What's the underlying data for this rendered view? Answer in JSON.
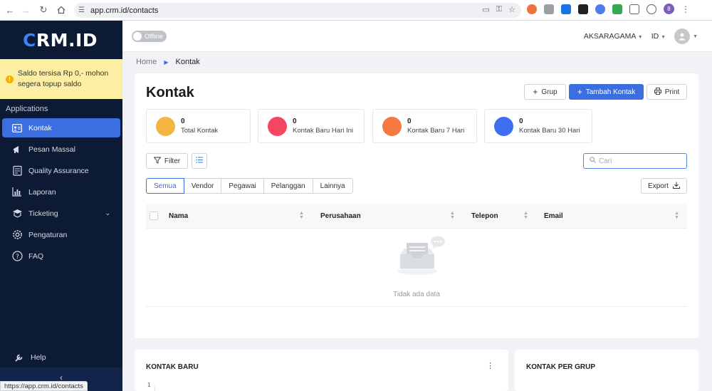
{
  "browser": {
    "url": "app.crm.id/contacts",
    "profile_initial": "8",
    "status_url": "https://app.crm.id/contacts"
  },
  "sidebar": {
    "logo": "CRM.ID",
    "logo_rest": "RM.ID",
    "balance_notice": "Saldo tersisa Rp 0,- mohon segera topup saldo",
    "section_label": "Applications",
    "items": [
      {
        "label": "Kontak",
        "icon": "contact-card-icon",
        "active": true
      },
      {
        "label": "Pesan Massal",
        "icon": "bullhorn-icon"
      },
      {
        "label": "Quality Assurance",
        "icon": "clipboard-check-icon"
      },
      {
        "label": "Laporan",
        "icon": "bar-chart-icon"
      },
      {
        "label": "Ticketing",
        "icon": "ticket-icon",
        "has_submenu": true
      },
      {
        "label": "Pengaturan",
        "icon": "gear-icon"
      },
      {
        "label": "FAQ",
        "icon": "question-icon"
      }
    ],
    "help_label": "Help"
  },
  "topbar": {
    "status_toggle": "Offline",
    "organization": "AKSARAGAMA",
    "language": "ID"
  },
  "breadcrumb": {
    "home": "Home",
    "current": "Kontak"
  },
  "main": {
    "title": "Kontak",
    "buttons": {
      "group": "Grup",
      "add_contact": "Tambah Kontak",
      "print": "Print"
    },
    "stats": [
      {
        "value": "0",
        "label": "Total Kontak",
        "color": "#f4b642"
      },
      {
        "value": "0",
        "label": "Kontak Baru Hari Ini",
        "color": "#f2475f"
      },
      {
        "value": "0",
        "label": "Kontak Baru 7 Hari",
        "color": "#f47a42"
      },
      {
        "value": "0",
        "label": "Kontak Baru 30 Hari",
        "color": "#3f6ff0"
      }
    ],
    "filter_label": "Filter",
    "search_placeholder": "Cari",
    "tabs": [
      "Semua",
      "Vendor",
      "Pegawai",
      "Pelanggan",
      "Lainnya"
    ],
    "active_tab": "Semua",
    "export_label": "Export",
    "table": {
      "columns": [
        "Nama",
        "Perusahaan",
        "Telepon",
        "Email"
      ],
      "rows": [],
      "empty_text": "Tidak ada data"
    }
  },
  "bottom_cards": {
    "new_contacts": {
      "title": "KONTAK BARU",
      "axis_first_tick": "1"
    },
    "contacts_per_group": {
      "title": "KONTAK PER GRUP"
    }
  },
  "colors": {
    "sidebar_bg": "#0c1a33",
    "accent": "#3b6fe0",
    "notice_bg": "#fcefa3"
  }
}
